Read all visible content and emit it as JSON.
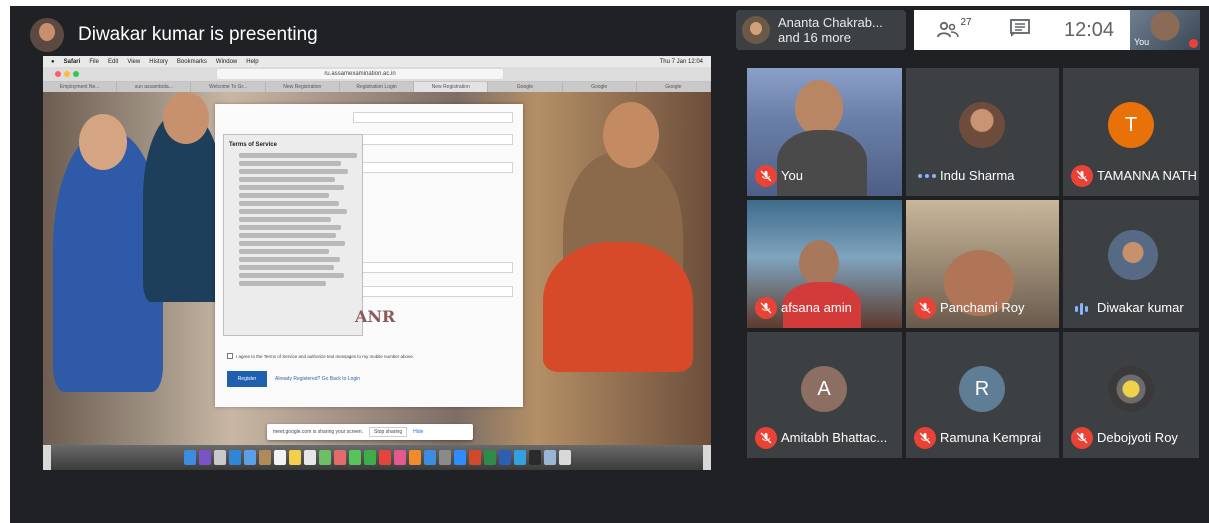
{
  "presenter": {
    "title": "Diwakar kumar is presenting"
  },
  "shared_screen": {
    "menubar": [
      "Safari",
      "File",
      "Edit",
      "View",
      "History",
      "Bookmarks",
      "Window",
      "Help"
    ],
    "clock": "Thu 7 Jan 12:04",
    "url": "ru.assamexamination.ac.in",
    "tabs": [
      "Employment Ne...",
      "sun assamtoda...",
      "Welcome To Gr...",
      "New Registration",
      "Registration Login",
      "New Registration",
      "Google",
      "Google",
      "Google"
    ],
    "terms_title": "Terms of Service",
    "terms_items": [
      "Assam University, its subsidiaries and affiliates may call and/or text me at any phone number I have provided or may provide in the future, including any wireless number.",
      "These calls and/or texts may include pre-recorded telemarketing calls.",
      "I am not required to give this consent.",
      "This consent will not impact my application in any way.",
      "Message and data rates may apply to any text messages sent or received as part of my wireless plan or service."
    ],
    "field_placeholders": [
      "Email Address",
      "Mobile",
      "Month",
      "Year"
    ],
    "radio_label": "Female",
    "captcha_text": "ANR",
    "agree_text": "I agree to the Terms of Service and authorize text messages to my mobile number above.",
    "register_label": "Register",
    "login_link": "Already Registered? Go Back to Login",
    "sharing_text": "meet.google.com is sharing your screen.",
    "stop_label": "Stop sharing",
    "hide_label": "Hide"
  },
  "top_controls": {
    "participants_pill": [
      "Ananta Chakrab...",
      "and 16 more"
    ],
    "people_count": "27",
    "time": "12:04",
    "self_label": "You"
  },
  "participants": [
    {
      "name": "You"
    },
    {
      "name": "Indu Sharma"
    },
    {
      "name": "TAMANNA NATH",
      "initial": "T"
    },
    {
      "name": "afsana amin"
    },
    {
      "name": "Panchami Roy"
    },
    {
      "name": "Diwakar kumar"
    },
    {
      "name": "Amitabh Bhattac...",
      "initial": "A"
    },
    {
      "name": "Ramuna Kemprai",
      "initial": "R"
    },
    {
      "name": "Debojyoti Roy"
    }
  ],
  "colors": {
    "meet_bg": "#202124",
    "tile_bg": "#3c4043",
    "mute_red": "#ea4335",
    "tamanna_orange": "#e8710a",
    "amitabh_brown": "#8d6e63",
    "ramuna_blue": "#5f7d95",
    "speaking_blue": "#8ab4f8"
  }
}
